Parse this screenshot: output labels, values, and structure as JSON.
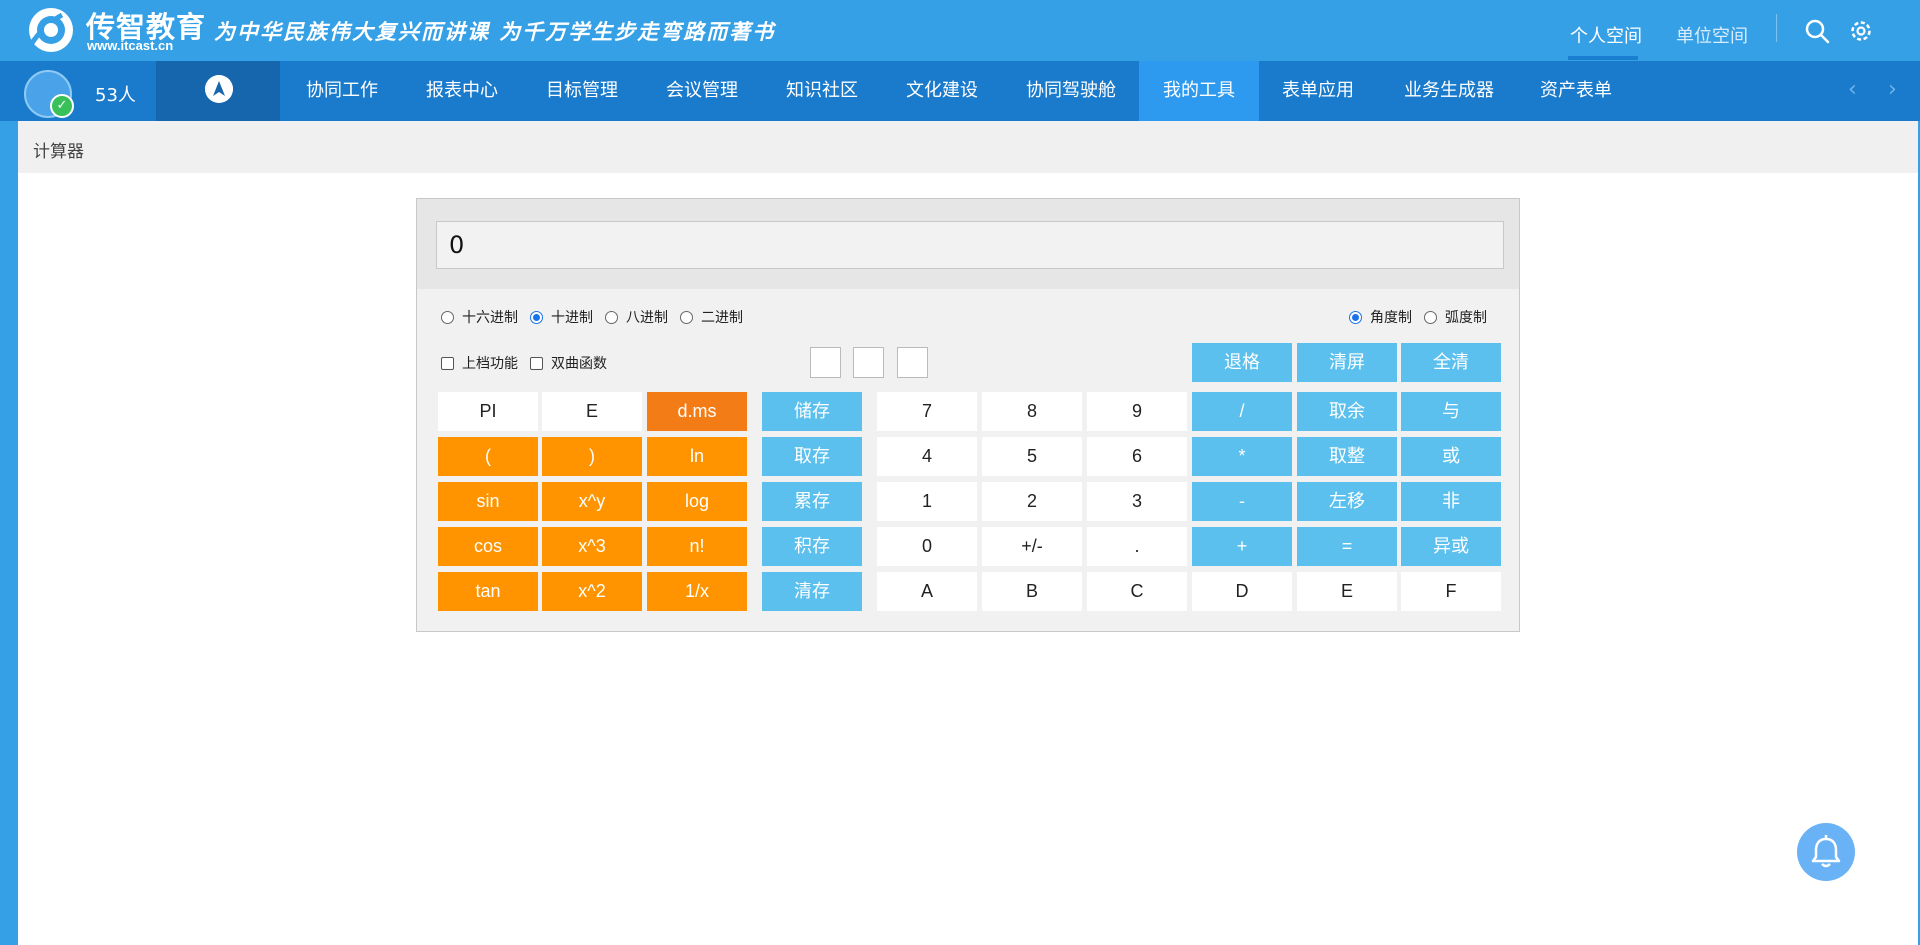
{
  "header": {
    "logo_name": "传智教育",
    "logo_url": "www.itcast.cn",
    "slogan": "为中华民族伟大复兴而讲课 为千万学生步走弯路而著书",
    "links": [
      "个人空间",
      "单位空间"
    ],
    "icons": [
      "search-icon",
      "gear-icon"
    ]
  },
  "nav": {
    "people_count": "53人",
    "items": [
      "协同工作",
      "报表中心",
      "目标管理",
      "会议管理",
      "知识社区",
      "文化建设",
      "协同驾驶舱",
      "我的工具",
      "表单应用",
      "业务生成器",
      "资产表单"
    ],
    "active_item": "我的工具",
    "arrows": [
      "‹",
      "›"
    ]
  },
  "breadcrumb": "计算器",
  "calculator": {
    "display": "0",
    "bases": [
      "十六进制",
      "十进制",
      "八进制",
      "二进制"
    ],
    "selected_base": "十进制",
    "angle_units": [
      "角度制",
      "弧度制"
    ],
    "selected_angle": "角度制",
    "options": [
      "上档功能",
      "双曲函数"
    ],
    "top_buttons": [
      "退格",
      "清屏",
      "全清"
    ],
    "rows": [
      [
        "PI",
        "E",
        "d.ms",
        "储存",
        "7",
        "8",
        "9",
        "/",
        "取余",
        "与"
      ],
      [
        "(",
        ")",
        "ln",
        "取存",
        "4",
        "5",
        "6",
        "*",
        "取整",
        "或"
      ],
      [
        "sin",
        "x^y",
        "log",
        "累存",
        "1",
        "2",
        "3",
        "-",
        "左移",
        "非"
      ],
      [
        "cos",
        "x^3",
        "n!",
        "积存",
        "0",
        "+/-",
        ".",
        "+",
        "=",
        "异或"
      ],
      [
        "tan",
        "x^2",
        "1/x",
        "清存",
        "A",
        "B",
        "C",
        "D",
        "E",
        "F"
      ]
    ]
  },
  "colors": {
    "header_bg": "#36a0e6",
    "nav_bg": "#1a7bcd",
    "nav_active": "#2d9af0",
    "orange": "#ff9400",
    "blue_button": "#5bc0ee"
  }
}
